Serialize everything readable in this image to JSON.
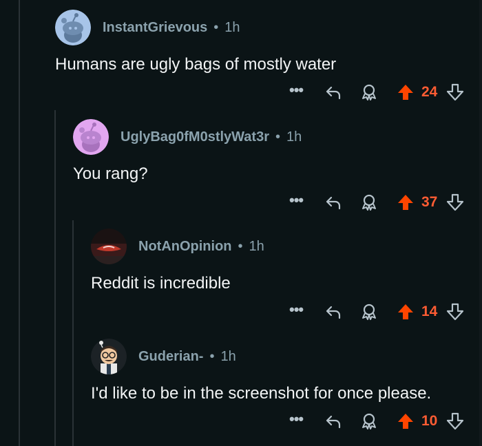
{
  "comments": [
    {
      "username": "InstantGrievous",
      "time": "1h",
      "text": "Humans are ugly bags of mostly water",
      "score": "24",
      "avatar_icon": "snoo-avatar-blue-icon"
    },
    {
      "username": "UglyBag0fM0stlyWat3r",
      "time": "1h",
      "text": "You rang?",
      "score": "37",
      "avatar_icon": "snoo-avatar-purple-icon"
    },
    {
      "username": "NotAnOpinion",
      "time": "1h",
      "text": "Reddit is incredible",
      "score": "14",
      "avatar_icon": "photo-avatar-icon"
    },
    {
      "username": "Guderian-",
      "time": "1h",
      "text": "I'd like to be in the screenshot for once please.",
      "score": "10",
      "avatar_icon": "cartoon-avatar-icon"
    }
  ],
  "separator": "•",
  "more_label": "•••",
  "colors": {
    "background": "#0b1416",
    "username": "#8ba2ad",
    "upvote_active": "#ff4500",
    "score": "#ff5c33",
    "icon": "#b7c4cc",
    "thread_line": "#2a3236"
  }
}
